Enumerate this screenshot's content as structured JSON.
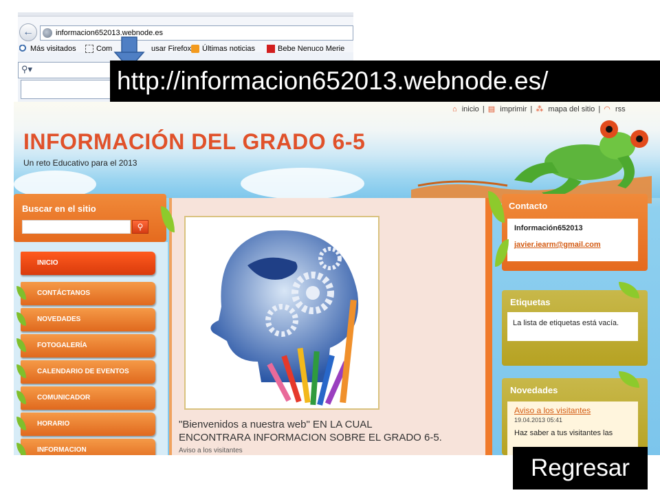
{
  "browser": {
    "url": "informacion652013.webnode.es",
    "bookmarks": [
      {
        "label": "Más visitados",
        "icon": "magnifier-icon"
      },
      {
        "label": "Com",
        "icon": "page-icon"
      },
      {
        "label": "usar Firefox",
        "icon": "firefox-icon"
      },
      {
        "label": "Últimas noticias",
        "icon": "rss-icon"
      },
      {
        "label": "Bebe Nenuco Merie",
        "icon": "red-tile-icon"
      }
    ],
    "search_dropdown": "▾"
  },
  "url_banner": "http://informacion652013.webnode.es/",
  "site": {
    "top_links": [
      "inicio",
      "imprimir",
      "mapa del sitio",
      "rss"
    ],
    "title": "INFORMACIÓN DEL GRADO 6-5",
    "subtitle": "Un reto Educativo para el 2013",
    "search_label": "Buscar en el sitio",
    "nav": [
      "INICIO",
      "CONTÁCTANOS",
      "NOVEDADES",
      "FOTOGALERÍA",
      "CALENDARIO DE EVENTOS",
      "COMUNICADOR",
      "HORARIO",
      "INFORMACION"
    ],
    "welcome_line1": "\"Bienvenidos a nuestra web\"  EN LA CUAL",
    "welcome_line2": "ENCONTRARA INFORMACION SOBRE EL GRADO 6-5.",
    "welcome_small": "Aviso a los visitantes",
    "contact": {
      "header": "Contacto",
      "name": "Información652013",
      "email": "javier.iearm@gmail.com"
    },
    "tags": {
      "header": "Etiquetas",
      "text": "La lista de etiquetas está vacía."
    },
    "news": {
      "header": "Novedades",
      "link": "Aviso a los visitantes",
      "date": "19.04.2013 05:41",
      "text": "Haz saber a tus visitantes las"
    }
  },
  "regresar": "Regresar",
  "colors": {
    "accent_orange": "#e56a1e",
    "title_orange": "#e0512a",
    "olive": "#b6a222"
  }
}
